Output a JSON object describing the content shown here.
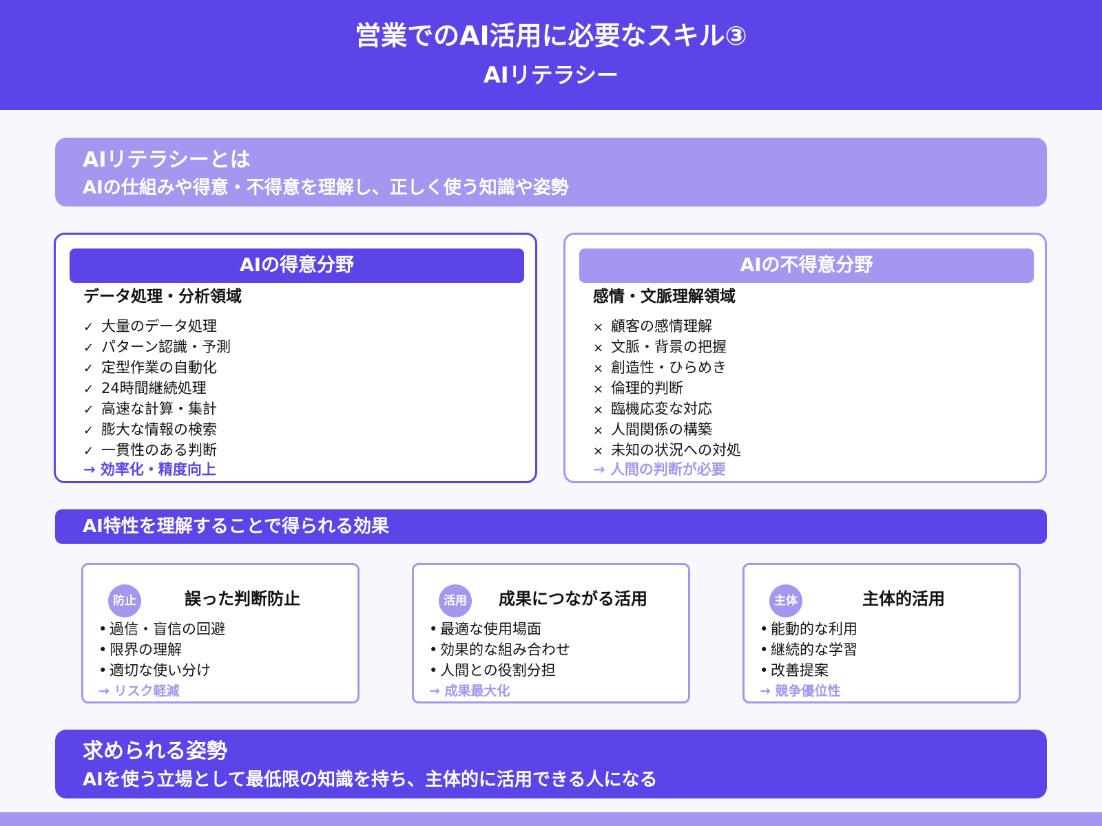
{
  "header": {
    "title": "営業でのAI活用に必要なスキル③",
    "subtitle": "AIリテラシー"
  },
  "definition": {
    "heading": "AIリテラシーとは",
    "text": "AIの仕組みや得意・不得意を理解し、正しく使う知識や姿勢"
  },
  "strengths": {
    "heading": "AIの得意分野",
    "subheading": "データ処理・分析領域",
    "marker": "✓",
    "items": [
      "大量のデータ処理",
      "パターン認識・予測",
      "定型作業の自動化",
      "24時間継続処理",
      "高速な計算・集計",
      "膨大な情報の検索",
      "一貫性のある判断"
    ],
    "result": "→ 効率化・精度向上"
  },
  "weaknesses": {
    "heading": "AIの不得意分野",
    "subheading": "感情・文脈理解領域",
    "marker": "×",
    "items": [
      "顧客の感情理解",
      "文脈・背景の把握",
      "創造性・ひらめき",
      "倫理的判断",
      "臨機応変な対応",
      "人間関係の構築",
      "未知の状況への対処"
    ],
    "result": "→ 人間の判断が必要"
  },
  "effects": {
    "heading": "AI特性を理解することで得られる効果",
    "cards": [
      {
        "badge": "防止",
        "title": "誤った判断防止",
        "items": [
          "過信・盲信の回避",
          "限界の理解",
          "適切な使い分け"
        ],
        "result": "→ リスク軽減"
      },
      {
        "badge": "活用",
        "title": "成果につながる活用",
        "items": [
          "最適な使用場面",
          "効果的な組み合わせ",
          "人間との役割分担"
        ],
        "result": "→ 成果最大化"
      },
      {
        "badge": "主体",
        "title": "主体的活用",
        "items": [
          "能動的な利用",
          "継続的な学習",
          "改善提案"
        ],
        "result": "→ 競争優位性"
      }
    ]
  },
  "stance": {
    "heading": "求められる姿勢",
    "text": "AIを使う立場として最低限の知識を持ち、主体的に活用できる人になる"
  },
  "colors": {
    "primary": "#5b45e8",
    "secondary": "#a497ef",
    "background": "#f7f7fd"
  }
}
